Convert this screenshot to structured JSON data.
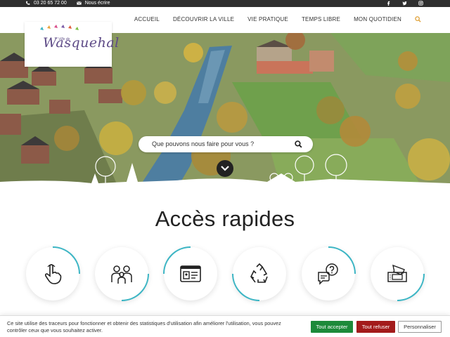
{
  "topbar": {
    "phone": "03 20 65 72 00",
    "write": "Nous écrire",
    "social": [
      "facebook-icon",
      "twitter-icon",
      "instagram-icon"
    ],
    "background": "#2f2f2f"
  },
  "logo": {
    "small_text": "Ville de",
    "name": "Wasquehal",
    "color": "#5d4a86"
  },
  "nav": {
    "items": [
      "ACCUEIL",
      "DÉCOUVRIR LA VILLE",
      "VIE PRATIQUE",
      "TEMPS LIBRE",
      "MON QUOTIDIEN"
    ],
    "search_icon_color": "#e0a23a"
  },
  "hero": {
    "search_placeholder": "Que pouvons nous faire pour vous ?"
  },
  "acces": {
    "title": "Accès rapides",
    "tiles": [
      {
        "icon": "pointer-hand-icon",
        "accent": "#3bb5c4"
      },
      {
        "icon": "family-icon",
        "accent": "#3bb5c4"
      },
      {
        "icon": "id-card-icon",
        "accent": "#3bb5c4"
      },
      {
        "icon": "recycle-icon",
        "accent": "#3bb5c4"
      },
      {
        "icon": "question-chat-icon",
        "accent": "#3bb5c4"
      },
      {
        "icon": "tickets-icon",
        "accent": "#3bb5c4"
      }
    ]
  },
  "cookie": {
    "message": "Ce site utilise des traceurs pour fonctionner et obtenir des statistiques d'utilisation afin améliorer l'utilisation, vous pouvez contrôler ceux que vous souhaitez activer.",
    "accept": "Tout accepter",
    "refuse": "Tout refuser",
    "customize": "Personnaliser",
    "accept_color": "#1d8a3a",
    "refuse_color": "#a31b1b"
  }
}
